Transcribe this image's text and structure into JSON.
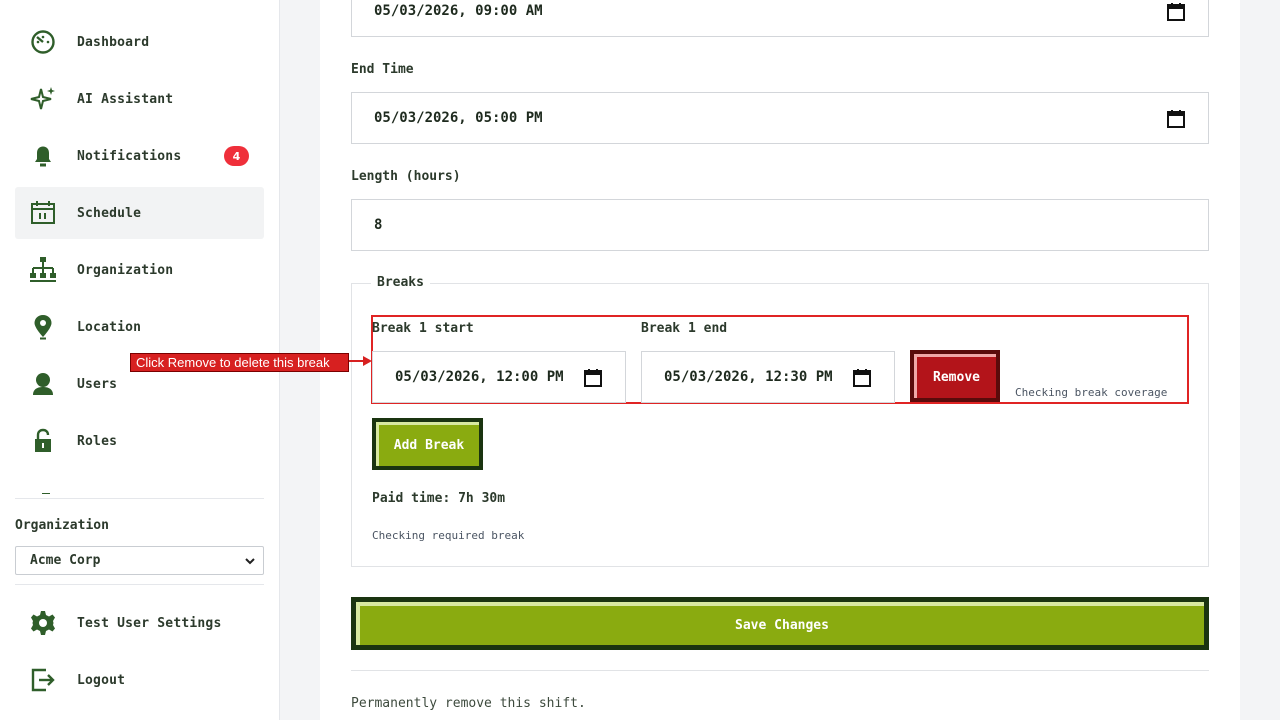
{
  "sidebar": {
    "items": [
      {
        "label": "Dashboard",
        "icon": "dashboard-icon"
      },
      {
        "label": "AI Assistant",
        "icon": "sparkle-icon"
      },
      {
        "label": "Notifications",
        "icon": "bell-icon",
        "badge": "4"
      },
      {
        "label": "Schedule",
        "icon": "calendar-icon",
        "active": true
      },
      {
        "label": "Organization",
        "icon": "org-chart-icon"
      },
      {
        "label": "Location",
        "icon": "map-pin-icon"
      },
      {
        "label": "Users",
        "icon": "user-icon"
      },
      {
        "label": "Roles",
        "icon": "lock-icon"
      }
    ],
    "organization_label": "Organization",
    "organization_value": "Acme Corp",
    "footer_items": [
      {
        "label": "Test User Settings",
        "icon": "gear-icon"
      },
      {
        "label": "Logout",
        "icon": "logout-icon"
      }
    ]
  },
  "form": {
    "start_time_value": "05/03/2026, 09:00 AM",
    "end_time_label": "End Time",
    "end_time_value": "05/03/2026, 05:00 PM",
    "length_label": "Length (hours)",
    "length_value": "8",
    "breaks": {
      "legend": "Breaks",
      "break_start_label": "Break 1 start",
      "break_start_value": "05/03/2026, 12:00 PM",
      "break_end_label": "Break 1 end",
      "break_end_value": "05/03/2026, 12:30 PM",
      "remove_label": "Remove",
      "coverage_note": "Checking break coverage",
      "add_label": "Add Break",
      "paid_time": "Paid time: 7h 30m",
      "required_note": "Checking required break"
    },
    "save_label": "Save Changes",
    "delete_note": "Permanently remove this shift."
  },
  "annotation": {
    "text": "Click Remove to delete this break"
  },
  "colors": {
    "accent_green": "#8aab10",
    "dark_green": "#1a3410",
    "danger_red": "#b3141a",
    "badge_red": "#ef2f3a",
    "icon_green": "#2f5e2a"
  }
}
